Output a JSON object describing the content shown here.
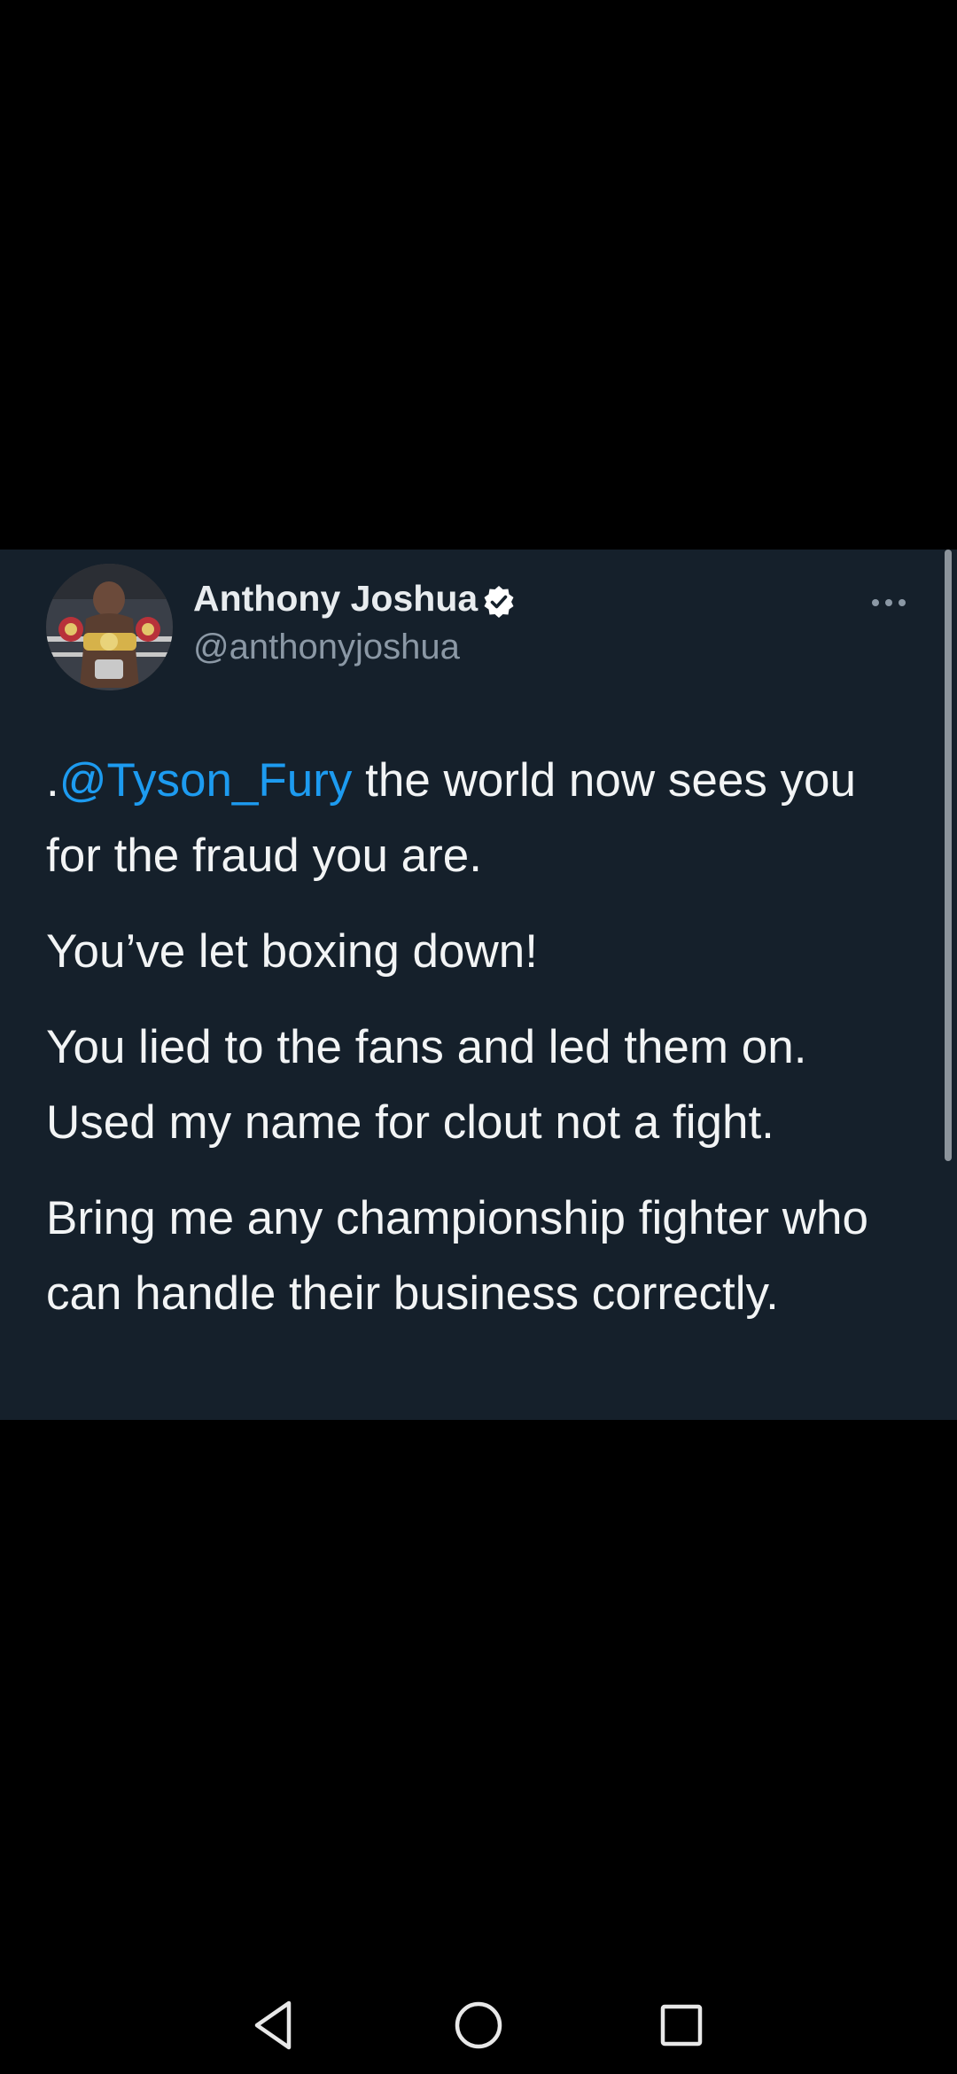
{
  "tweet": {
    "author": {
      "name": "Anthony Joshua",
      "handle": "@anthonyjoshua",
      "verified": true,
      "avatar_icon": "avatar-boxer-with-belts"
    },
    "text": {
      "line1_prefix": ".",
      "mention": "@Tyson_Fury",
      "line1_rest": " the world now sees you for the fraud you are.",
      "paragraph2": "You’ve let boxing down!",
      "paragraph3": "You lied to the fans and led them on. Used my name for clout not a fight.",
      "paragraph4": "Bring me any championship fighter who can handle their business correctly."
    },
    "colors": {
      "card_background": "#15202b",
      "mention": "#1d9bf0",
      "text": "#f2f4f5",
      "handle": "#8b98a5"
    }
  },
  "system_nav": {
    "back_icon": "triangle-back-icon",
    "home_icon": "circle-home-icon",
    "recents_icon": "square-recents-icon"
  }
}
